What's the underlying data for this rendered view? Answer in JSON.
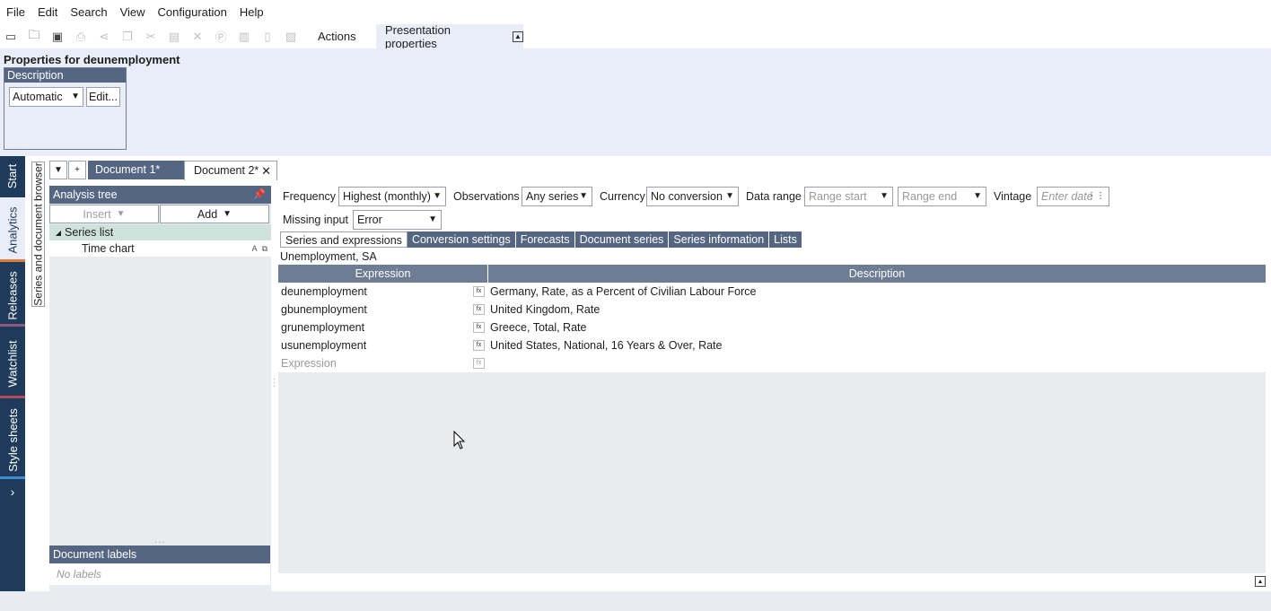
{
  "menu": [
    "File",
    "Edit",
    "Search",
    "View",
    "Configuration",
    "Help"
  ],
  "toolbar": {
    "actions_label": "Actions",
    "presentation_label": "Presentation properties"
  },
  "properties": {
    "title": "Properties for deunemployment",
    "description_header": "Description",
    "description_mode": "Automatic",
    "edit_label": "Edit..."
  },
  "side_tabs": [
    "Start",
    "Analytics",
    "Releases",
    "Watchlist",
    "Style sheets"
  ],
  "browser_tab": "Series and document browser",
  "doc_tabs": {
    "doc1": "Document 1*",
    "doc2": "Document 2*"
  },
  "analysis_tree": {
    "title": "Analysis tree",
    "insert_label": "Insert",
    "add_label": "Add",
    "items": [
      "Series list",
      "Time chart"
    ]
  },
  "document_labels": {
    "title": "Document labels",
    "empty": "No labels"
  },
  "filters": {
    "frequency_label": "Frequency",
    "frequency_value": "Highest (monthly)",
    "observations_label": "Observations",
    "observations_value": "Any series",
    "currency_label": "Currency",
    "currency_value": "No conversion",
    "data_range_label": "Data range",
    "range_start": "Range start",
    "range_end": "Range end",
    "vintage_label": "Vintage",
    "vintage_placeholder": "Enter date",
    "missing_label": "Missing input",
    "missing_value": "Error"
  },
  "sub_tabs": [
    "Series and expressions",
    "Conversion settings",
    "Forecasts",
    "Document series",
    "Series information",
    "Lists"
  ],
  "grid": {
    "title": "Unemployment, SA",
    "col_expression": "Expression",
    "col_description": "Description",
    "rows": [
      {
        "expr": "deunemployment",
        "desc": "Germany, Rate, as a Percent of Civilian Labour Force"
      },
      {
        "expr": "gbunemployment",
        "desc": "United Kingdom, Rate"
      },
      {
        "expr": "grunemployment",
        "desc": "Greece, Total, Rate"
      },
      {
        "expr": "usunemployment",
        "desc": "United States, National, 16 Years & Over, Rate"
      }
    ],
    "placeholder": "Expression",
    "fx_label": "fx"
  },
  "colors": {
    "accent": "#556683",
    "sidebar": "#1f3b5b"
  }
}
